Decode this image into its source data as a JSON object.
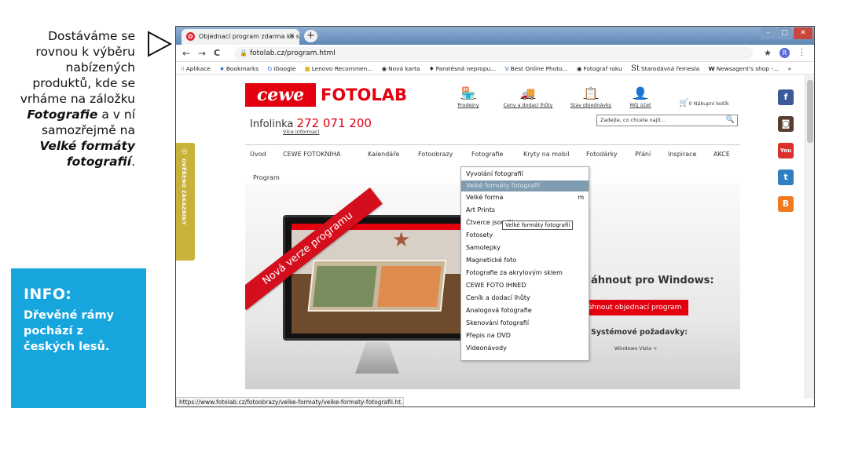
{
  "caption": {
    "plain1": "Dostáváme se rovnou k výběru nabízených produktů, kde se vrháme na záložku",
    "bold1": "Fotografie",
    "plain2": "a v ní samozřejmě na",
    "bold2": "Velké formáty fotografií",
    "period": "."
  },
  "info": {
    "heading": "INFO:",
    "text": "Dřevěné rámy pochází z českých lesů."
  },
  "browser": {
    "tab_title": "Objednací program zdarma ke st",
    "tab_close": "×",
    "new_tab": "+",
    "url": "fotolab.cz/program.html",
    "nav_back": "←",
    "nav_forward": "→",
    "nav_reload": "C",
    "profile_initial": "R",
    "status_url": "https://www.fotolab.cz/fotoobrazy/velke-formaty/velke-formaty-fotografii.ht...",
    "bookmarks": [
      "Aplikace",
      "Bookmarks",
      "iGoogle",
      "Lenovo Recommen...",
      "Nová karta",
      "Parotěsná nepropu...",
      "Best Online Photo...",
      "Fotograf roku",
      "Starodávná řemesla",
      "Newsagent's shop -..."
    ]
  },
  "site": {
    "logo_cewe": "cewe",
    "logo_fotolab": "FOTOLAB",
    "top_links": [
      "Prodejny",
      "Ceny a dodací lhůty",
      "Stav objednávky",
      "Můj účet"
    ],
    "cart": "0 Nákupní košík",
    "infolinka_label": "Infolinka",
    "infolinka_number": "272 071 200",
    "vice": "Více informací",
    "search_placeholder": "Zadejte, co chcete najít...",
    "menu": [
      "Úvod",
      "CEWE FOTOKNIHA",
      "Kalendáře",
      "Fotoobrazy",
      "Fotografie",
      "Kryty na mobil",
      "Fotodárky",
      "Přání",
      "Inspirace",
      "AKCE"
    ],
    "breadcrumb": "Program",
    "ribbon": "Nová verze programu",
    "download_title": "áhnout pro Windows:",
    "download_button": "áhnout objednací program",
    "requirements": "Systémové požadavky:",
    "os": "Windows Vista +",
    "side_tab": "OVĚŘENO ZÁKAZNÍKY",
    "dropdown": [
      "Vyvolání fotografií",
      "Velké formáty fotografií",
      "Velké forma",
      "Art Prints",
      "Čtverce jsou IN",
      "Fotosety",
      "Samolepky",
      "Magnetické foto",
      "Fotografie za akrylovým sklem",
      "CEWE FOTO IHNED",
      "Ceník a dodací lhůty",
      "Analogová fotografie",
      "Skenování fotografií",
      "Přepis na DVD",
      "Videonávody"
    ],
    "dropdown_extra": "m",
    "tooltip": "Velké formáty fotografií",
    "social": [
      "f",
      "◙",
      "You",
      "t",
      "B"
    ]
  },
  "colors": {
    "accent": "#e3000f",
    "info_box": "#17a5de",
    "facebook": "#3b5998",
    "instagram": "#5a3d31",
    "youtube": "#d9302c",
    "twitter": "#2f7fc1",
    "blogger": "#f07a22"
  }
}
